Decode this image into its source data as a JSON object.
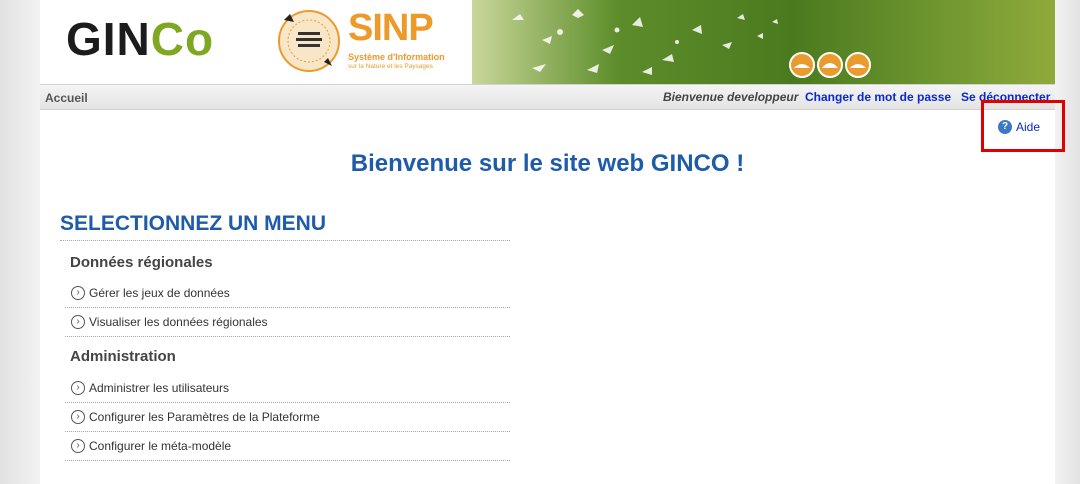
{
  "banner": {
    "logo_main": "GIN",
    "logo_accent": "Co",
    "sinp_title": "SINP",
    "sinp_subtitle": "Système d'Information",
    "sinp_subtitle2": "sur la Nature et les Paysages",
    "brand_color": "#7ea822",
    "sinp_color": "#ee9a2a"
  },
  "topnav": {
    "home": "Accueil",
    "welcome": "Bienvenue developpeur",
    "change_password": "Changer de mot de passe",
    "logout": "Se déconnecter"
  },
  "help": {
    "label": "Aide",
    "icon": "question-circle-icon"
  },
  "main": {
    "title": "Bienvenue sur le site web GINCO !",
    "menu_heading": "SELECTIONNEZ UN MENU",
    "sections": [
      {
        "title": "Données régionales",
        "items": [
          "Gérer les jeux de données",
          "Visualiser les données régionales"
        ]
      },
      {
        "title": "Administration",
        "items": [
          "Administrer les utilisateurs",
          "Configurer les Paramètres de la Plateforme",
          "Configurer le méta-modèle"
        ]
      }
    ]
  },
  "colors": {
    "title_blue": "#1e5ba8",
    "link_blue": "#0a2ac9",
    "highlight_red": "#e00000"
  }
}
